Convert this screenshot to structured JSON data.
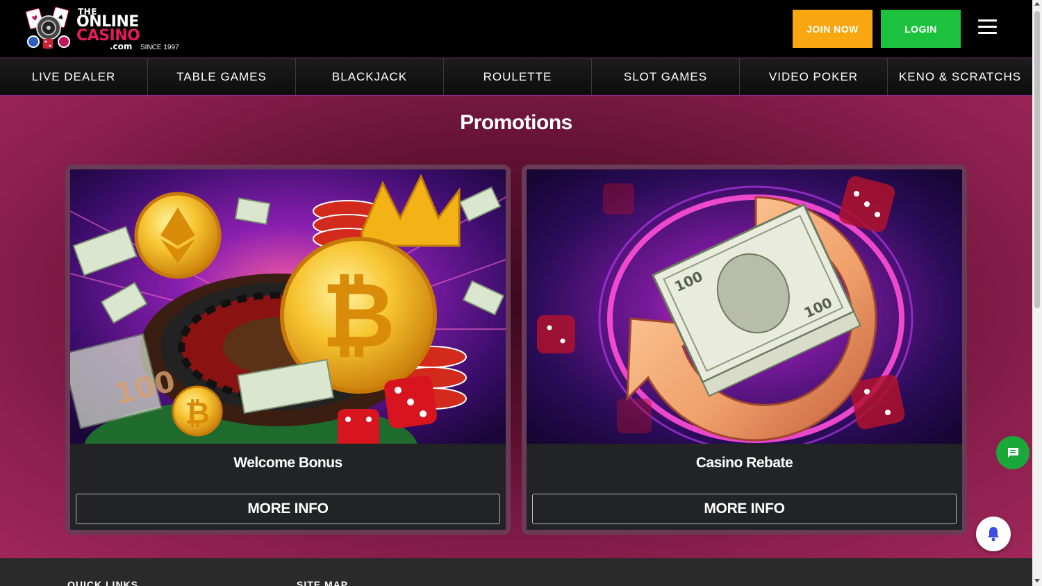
{
  "header": {
    "logo": {
      "line1": "THE",
      "line2": "ONLINE",
      "line3": "CASINO",
      "line4": ".com",
      "since": "SINCE 1997"
    },
    "join_label": "JOIN NOW",
    "login_label": "LOGIN",
    "menu_icon": "hamburger-menu-icon"
  },
  "nav": {
    "items": [
      {
        "label": "LIVE DEALER"
      },
      {
        "label": "TABLE GAMES"
      },
      {
        "label": "BLACKJACK"
      },
      {
        "label": "ROULETTE"
      },
      {
        "label": "SLOT GAMES"
      },
      {
        "label": "VIDEO POKER"
      },
      {
        "label": "KENO & SCRATCHS"
      }
    ]
  },
  "main": {
    "title": "Promotions",
    "cards": [
      {
        "title": "Welcome Bonus",
        "button": "MORE INFO"
      },
      {
        "title": "Casino Rebate",
        "button": "MORE INFO"
      }
    ]
  },
  "footer": {
    "headings": [
      "QUICK LINKS",
      "SITE MAP"
    ]
  },
  "colors": {
    "join": "#f9a710",
    "login": "#1cc13d",
    "accent": "#e51b5b",
    "chat": "#1aa83a",
    "bell": "#3b4ce0"
  }
}
